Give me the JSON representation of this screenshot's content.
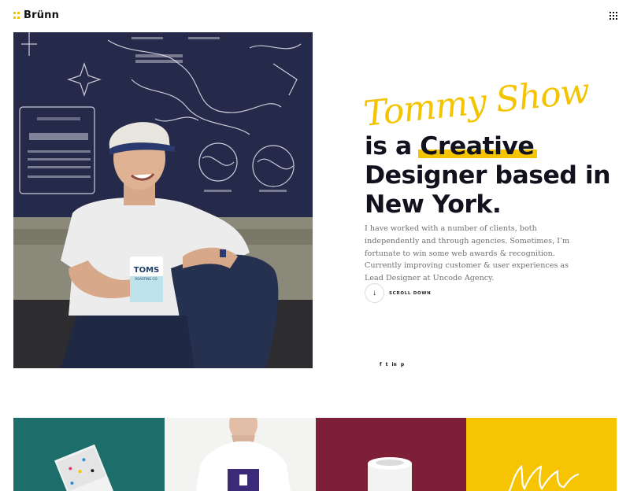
{
  "brand": {
    "name": "Brünn",
    "accent": "#f5c400"
  },
  "header": {
    "menu_icon": "grid-menu-icon"
  },
  "hero": {
    "signature": "Tommy Show",
    "headline_part1": "is a ",
    "headline_highlight": "Creative",
    "headline_part2": "Designer based in New York.",
    "intro": "I have worked with a number of clients, both independently and through agencies. Sometimes, I’m fortunate to win some web awards & recognition. Currently improving customer & user experiences as Lead Designer at Uncode Agency.",
    "scroll_label": "SCROLL DOWN",
    "scroll_icon": "arrow-down-icon"
  },
  "photo": {
    "mug_brand": "TOMS",
    "mug_subtext": "ROASTING CO."
  },
  "social": [
    {
      "icon": "facebook-icon",
      "glyph": "f"
    },
    {
      "icon": "twitter-icon",
      "glyph": "t"
    },
    {
      "icon": "linkedin-icon",
      "glyph": "in"
    },
    {
      "icon": "pinterest-icon",
      "glyph": "p"
    }
  ],
  "portfolio": {
    "tiles": [
      {
        "color": "#1d6e6b"
      },
      {
        "color": "#f3f3f1"
      },
      {
        "color": "#7e1f38"
      },
      {
        "color": "#f6c402"
      }
    ]
  }
}
